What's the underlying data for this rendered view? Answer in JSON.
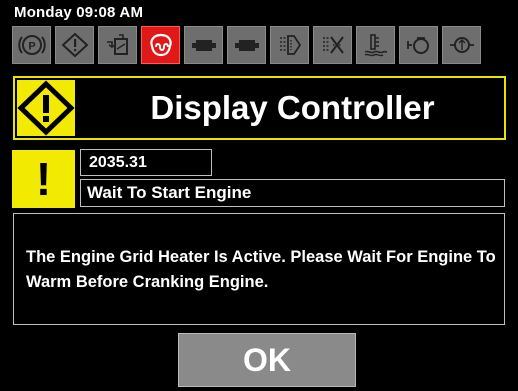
{
  "status": {
    "datetime": "Monday 09:08 AM"
  },
  "indicators": [
    {
      "name": "parking-brake-icon",
      "label": "(P)",
      "active": false
    },
    {
      "name": "warning-diamond-icon",
      "label": "!",
      "active": false
    },
    {
      "name": "fuel-filter-icon",
      "label": "",
      "active": false
    },
    {
      "name": "grid-heater-icon",
      "label": "",
      "active": true
    },
    {
      "name": "battery-icon",
      "label": "",
      "active": false
    },
    {
      "name": "battery-alt-icon",
      "label": "",
      "active": false
    },
    {
      "name": "air-filter-icon",
      "label": "",
      "active": false
    },
    {
      "name": "coolant-icon",
      "label": "",
      "active": false
    },
    {
      "name": "coolant-level-icon",
      "label": "",
      "active": false
    },
    {
      "name": "engine-icon",
      "label": "",
      "active": false
    },
    {
      "name": "oil-pressure-icon",
      "label": "",
      "active": false
    }
  ],
  "title": {
    "text": "Display Controller",
    "icon": "warning-diamond-icon"
  },
  "alert": {
    "icon_char": "!",
    "code": "2035.31",
    "title": "Wait To Start Engine",
    "message": "The Engine Grid Heater Is Active. Please Wait For Engine To Warm Before Cranking Engine."
  },
  "button": {
    "ok_label": "OK"
  },
  "colors": {
    "accent_yellow": "#f2ea00",
    "active_red": "#e01818",
    "indicator_gray": "#6e6e6e"
  }
}
